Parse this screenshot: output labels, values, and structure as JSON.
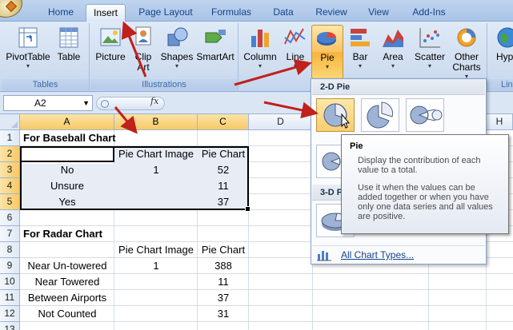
{
  "tabs": [
    {
      "label": "Home",
      "active": false
    },
    {
      "label": "Insert",
      "active": true
    },
    {
      "label": "Page Layout",
      "active": false
    },
    {
      "label": "Formulas",
      "active": false
    },
    {
      "label": "Data",
      "active": false
    },
    {
      "label": "Review",
      "active": false
    },
    {
      "label": "View",
      "active": false
    },
    {
      "label": "Add-Ins",
      "active": false
    }
  ],
  "ribbon": {
    "groups": {
      "tables": "Tables",
      "illustrations": "Illustrations",
      "charts_cut": "Lin"
    },
    "buttons": {
      "pivottable": "PivotTable",
      "table": "Table",
      "picture": "Picture",
      "clipart_1": "Clip",
      "clipart_2": "Art",
      "shapes": "Shapes",
      "smartart": "SmartArt",
      "column": "Column",
      "line": "Line",
      "pie": "Pie",
      "bar": "Bar",
      "area": "Area",
      "scatter": "Scatter",
      "other_1": "Other",
      "other_2": "Charts",
      "hyper_cut": "Hype"
    }
  },
  "formula_bar": {
    "name_box": "A2",
    "fx": "fx",
    "formula": ""
  },
  "sheet": {
    "columns": [
      "A",
      "B",
      "C",
      "D",
      "G",
      "H"
    ],
    "rows": [
      "1",
      "2",
      "3",
      "4",
      "5",
      "6",
      "7",
      "8",
      "9",
      "10",
      "11",
      "12",
      "13"
    ],
    "cells": {
      "a1": "For Baseball Chart",
      "b2": "Pie Chart Image",
      "c2": "Pie Chart",
      "a3": "No",
      "b3": "1",
      "c3": "52",
      "a4": "Unsure",
      "c4": "11",
      "a5": "Yes",
      "c5": "37",
      "a7": "For Radar Chart",
      "b8": "Pie Chart Image",
      "c8": "Pie Chart",
      "a9": "Near Un-towered",
      "b9": "1",
      "c9": "388",
      "a10": "Near Towered",
      "c10": "11",
      "a11": "Between Airports",
      "c11": "37",
      "a12": "Not Counted",
      "c12": "31"
    }
  },
  "dropdown": {
    "section_2d": "2-D Pie",
    "section_3d": "3-D P",
    "all_types": "All Chart Types..."
  },
  "tooltip": {
    "title": "Pie",
    "body1": "Display the contribution of each value to a total.",
    "body2": "Use it when the values can be added together or when you have only one data series and all values are positive."
  },
  "colors": {
    "accent_red": "#c0211b",
    "pressed": "#f9c263",
    "ribbon": "#dfeaf7"
  }
}
